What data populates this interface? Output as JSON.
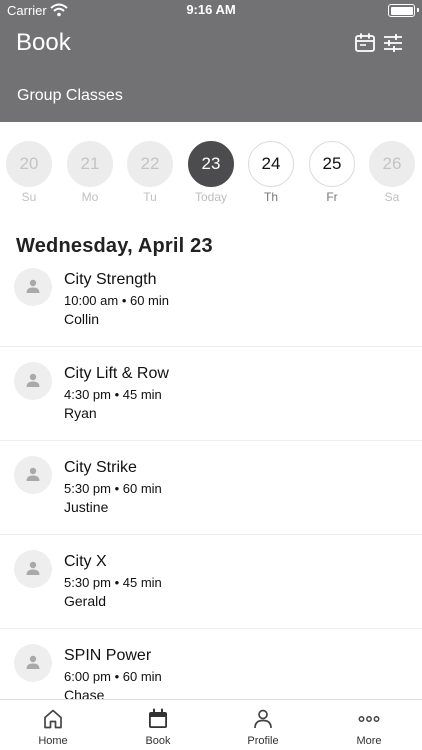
{
  "status_bar": {
    "carrier": "Carrier",
    "time": "9:16 AM"
  },
  "header": {
    "title": "Book",
    "section": "Group Classes",
    "icons": [
      "calendar-icon",
      "filter-icon"
    ],
    "background_color": "#727274"
  },
  "days": [
    {
      "number": "20",
      "label": "Su",
      "state": "disabled"
    },
    {
      "number": "21",
      "label": "Mo",
      "state": "disabled"
    },
    {
      "number": "22",
      "label": "Tu",
      "state": "disabled"
    },
    {
      "number": "23",
      "label": "Today",
      "state": "selected"
    },
    {
      "number": "24",
      "label": "Th",
      "state": "active"
    },
    {
      "number": "25",
      "label": "Fr",
      "state": "active"
    },
    {
      "number": "26",
      "label": "Sa",
      "state": "disabled-filled"
    }
  ],
  "date_heading": "Wednesday, April 23",
  "classes": [
    {
      "name": "City Strength",
      "time": "10:00 am • 60 min",
      "instructor": "Collin"
    },
    {
      "name": "City Lift & Row",
      "time": "4:30 pm • 45 min",
      "instructor": "Ryan"
    },
    {
      "name": "City Strike",
      "time": "5:30 pm • 60 min",
      "instructor": "Justine"
    },
    {
      "name": "City X",
      "time": "5:30 pm • 45 min",
      "instructor": "Gerald"
    },
    {
      "name": "SPIN Power",
      "time": "6:00 pm • 60 min",
      "instructor": "Chase"
    }
  ],
  "tabs": [
    {
      "label": "Home",
      "icon": "home-icon"
    },
    {
      "label": "Book",
      "icon": "calendar-icon"
    },
    {
      "label": "Profile",
      "icon": "profile-icon"
    },
    {
      "label": "More",
      "icon": "more-icon"
    }
  ],
  "selected_tab": "Book"
}
